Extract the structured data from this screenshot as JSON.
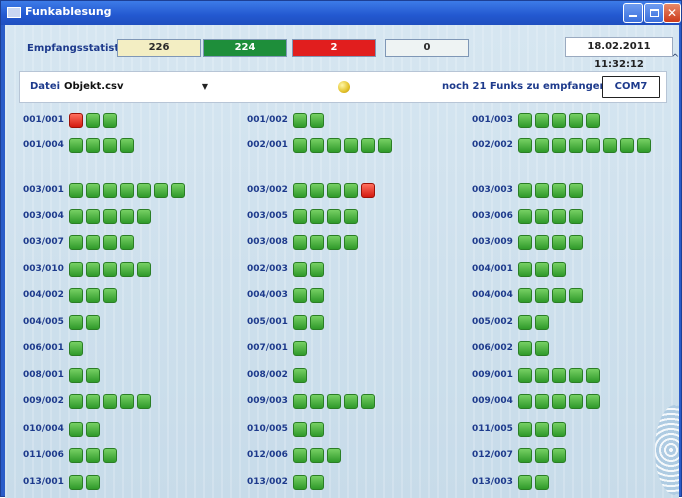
{
  "window": {
    "title": "Funkablesung",
    "icon": "app-icon",
    "controls": {
      "minimize": "",
      "maximize": "",
      "close": "✕"
    }
  },
  "stats": {
    "label": "Empfangsstatistik",
    "values": [
      "226",
      "224",
      "2",
      "0"
    ],
    "colors": [
      "#f3eec3",
      "#1e8e3a",
      "#e11e1e",
      "#eef3f3"
    ],
    "datetime": "18.02.2011 11:32:12"
  },
  "toolbar": {
    "datei_label": "Datei",
    "file_value": "Objekt.csv",
    "status_led": "yellow",
    "noch_text": "noch  21 Funks zu empfangen",
    "com_button": "COM7"
  },
  "stations": [
    {
      "id": "001/001",
      "ok": 2,
      "error": 1,
      "error_first": true
    },
    {
      "id": "001/002",
      "ok": 2,
      "error": 0
    },
    {
      "id": "001/003",
      "ok": 5,
      "error": 0
    },
    {
      "id": "001/004",
      "ok": 4,
      "error": 0
    },
    {
      "id": "002/001",
      "ok": 6,
      "error": 0
    },
    {
      "id": "002/002",
      "ok": 8,
      "error": 0
    },
    {
      "id": "003/001",
      "ok": 7,
      "error": 0
    },
    {
      "id": "003/002",
      "ok": 4,
      "error": 1
    },
    {
      "id": "003/003",
      "ok": 4,
      "error": 0
    },
    {
      "id": "003/004",
      "ok": 5,
      "error": 0
    },
    {
      "id": "003/005",
      "ok": 4,
      "error": 0
    },
    {
      "id": "003/006",
      "ok": 4,
      "error": 0
    },
    {
      "id": "003/007",
      "ok": 4,
      "error": 0
    },
    {
      "id": "003/008",
      "ok": 4,
      "error": 0
    },
    {
      "id": "003/009",
      "ok": 4,
      "error": 0
    },
    {
      "id": "003/010",
      "ok": 5,
      "error": 0
    },
    {
      "id": "002/003",
      "ok": 2,
      "error": 0
    },
    {
      "id": "004/001",
      "ok": 3,
      "error": 0
    },
    {
      "id": "004/002",
      "ok": 3,
      "error": 0
    },
    {
      "id": "004/003",
      "ok": 2,
      "error": 0
    },
    {
      "id": "004/004",
      "ok": 4,
      "error": 0
    },
    {
      "id": "004/005",
      "ok": 2,
      "error": 0
    },
    {
      "id": "005/001",
      "ok": 2,
      "error": 0
    },
    {
      "id": "005/002",
      "ok": 2,
      "error": 0
    },
    {
      "id": "006/001",
      "ok": 1,
      "error": 0
    },
    {
      "id": "007/001",
      "ok": 1,
      "error": 0
    },
    {
      "id": "006/002",
      "ok": 2,
      "error": 0
    },
    {
      "id": "008/001",
      "ok": 2,
      "error": 0
    },
    {
      "id": "008/002",
      "ok": 1,
      "error": 0
    },
    {
      "id": "009/001",
      "ok": 5,
      "error": 0
    },
    {
      "id": "009/002",
      "ok": 5,
      "error": 0
    },
    {
      "id": "009/003",
      "ok": 5,
      "error": 0
    },
    {
      "id": "009/004",
      "ok": 5,
      "error": 0
    },
    {
      "id": "010/004",
      "ok": 2,
      "error": 0
    },
    {
      "id": "010/005",
      "ok": 2,
      "error": 0
    },
    {
      "id": "011/005",
      "ok": 3,
      "error": 0
    },
    {
      "id": "011/006",
      "ok": 3,
      "error": 0
    },
    {
      "id": "012/006",
      "ok": 3,
      "error": 0
    },
    {
      "id": "012/007",
      "ok": 3,
      "error": 0
    },
    {
      "id": "013/001",
      "ok": 2,
      "error": 0
    },
    {
      "id": "013/002",
      "ok": 2,
      "error": 0
    },
    {
      "id": "013/003",
      "ok": 2,
      "error": 0
    }
  ]
}
